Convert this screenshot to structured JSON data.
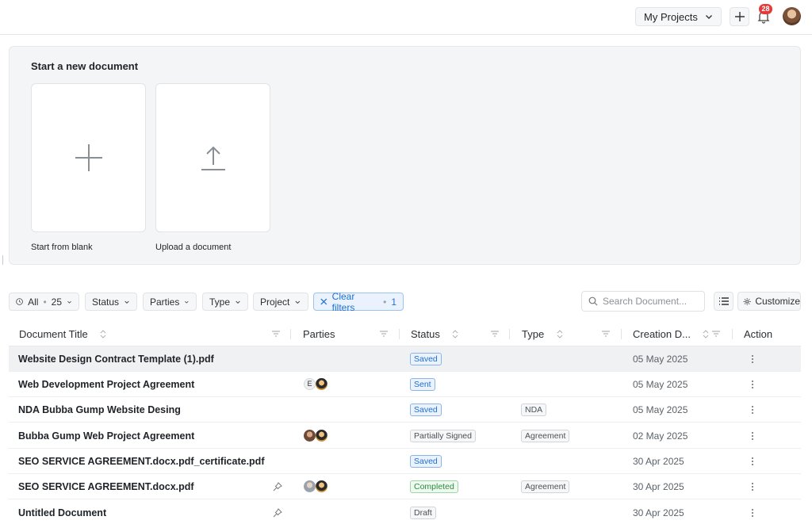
{
  "topbar": {
    "project_select": "My Projects",
    "notification_count": "28"
  },
  "new_document": {
    "title": "Start a new document",
    "blank_label": "Start from blank",
    "upload_label": "Upload a document"
  },
  "filters": {
    "all_label": "All",
    "all_count": "25",
    "status": "Status",
    "parties": "Parties",
    "type": "Type",
    "project": "Project",
    "clear_filters": "Clear filters",
    "clear_count": "1",
    "search_placeholder": "Search Document...",
    "customize": "Customize"
  },
  "table": {
    "columns": [
      "Document Title",
      "Parties",
      "Status",
      "Type",
      "Creation D...",
      "Action"
    ],
    "rows": [
      {
        "title": "Website Design Contract Template (1).pdf",
        "status": "Saved",
        "type": "",
        "date": "05 May 2025"
      },
      {
        "title": "Web Development Project Agreement",
        "parties_initial": "E",
        "status": "Sent",
        "type": "",
        "date": "05 May 2025"
      },
      {
        "title": "NDA Bubba Gump Website Desing",
        "status": "Saved",
        "type": "NDA",
        "date": "05 May 2025"
      },
      {
        "title": "Bubba Gump Web Project Agreement",
        "status": "Partially Signed",
        "type": "Agreement",
        "date": "02 May 2025"
      },
      {
        "title": "SEO SERVICE AGREEMENT.docx.pdf_certificate.pdf",
        "status": "Saved",
        "type": "",
        "date": "30 Apr 2025"
      },
      {
        "title": "SEO SERVICE AGREEMENT.docx.pdf",
        "status": "Completed",
        "type": "Agreement",
        "date": "30 Apr 2025"
      },
      {
        "title": "Untitled Document",
        "status": "Draft",
        "type": "",
        "date": "30 Apr 2025"
      }
    ]
  }
}
